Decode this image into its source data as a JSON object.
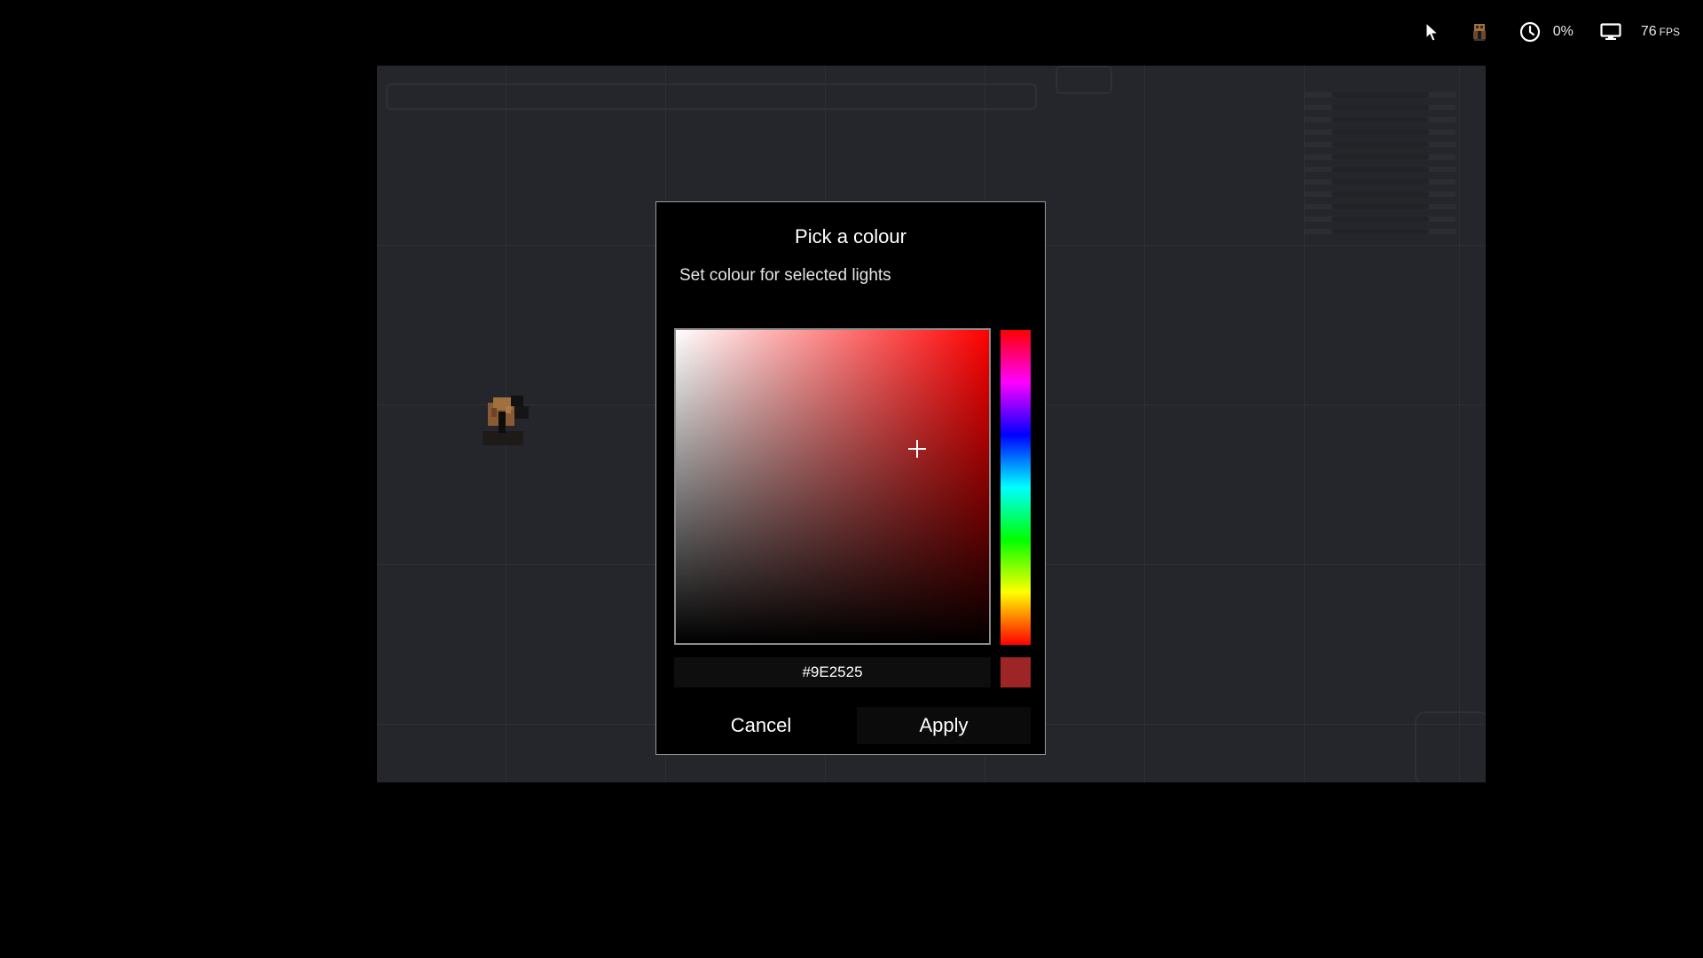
{
  "status_bar": {
    "icons": [
      "cursor-icon",
      "character-icon",
      "clock-icon",
      "monitor-icon"
    ],
    "load_text": "0%",
    "fps_value": "76",
    "fps_unit": "FPS"
  },
  "dialog": {
    "title": "Pick a colour",
    "subtitle": "Set colour for selected lights",
    "hex_value": "#9E2525",
    "selected_color": "#9E2525",
    "hue_color": "#FF0000",
    "picker_position": {
      "saturation": 0.77,
      "value": 0.62
    },
    "hue": 0,
    "cancel_label": "Cancel",
    "apply_label": "Apply"
  },
  "colors": {
    "background": "#000000",
    "scene": "#25262B",
    "dialog_border": "#9A9A9A"
  }
}
